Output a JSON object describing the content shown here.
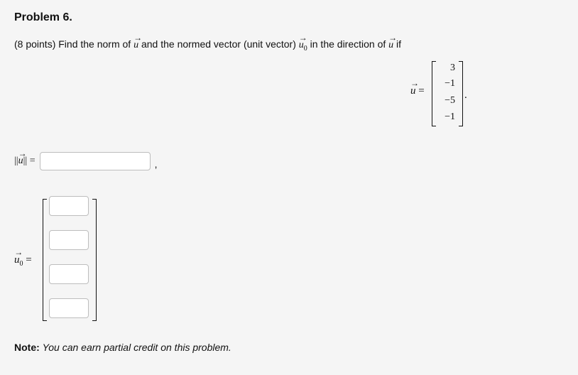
{
  "problem": {
    "title": "Problem 6.",
    "points": "(8 points)",
    "prompt_part1": "Find the norm of",
    "prompt_part2": "and the normed vector (unit vector)",
    "prompt_part3": "in the direction of",
    "prompt_part4": "if"
  },
  "vector_u": {
    "symbol": "u",
    "equals": "=",
    "entries": [
      "3",
      "−1",
      "−5",
      "−1"
    ],
    "end_punct": "."
  },
  "vector_u0": {
    "symbol": "u",
    "subscript": "0"
  },
  "norm_answer": {
    "label": "||u|| =",
    "value": "",
    "trailing": ","
  },
  "unit_vector_answer": {
    "label_equals": "=",
    "cells": [
      "",
      "",
      "",
      ""
    ]
  },
  "note": {
    "label": "Note:",
    "text": "You can earn partial credit on this problem."
  }
}
